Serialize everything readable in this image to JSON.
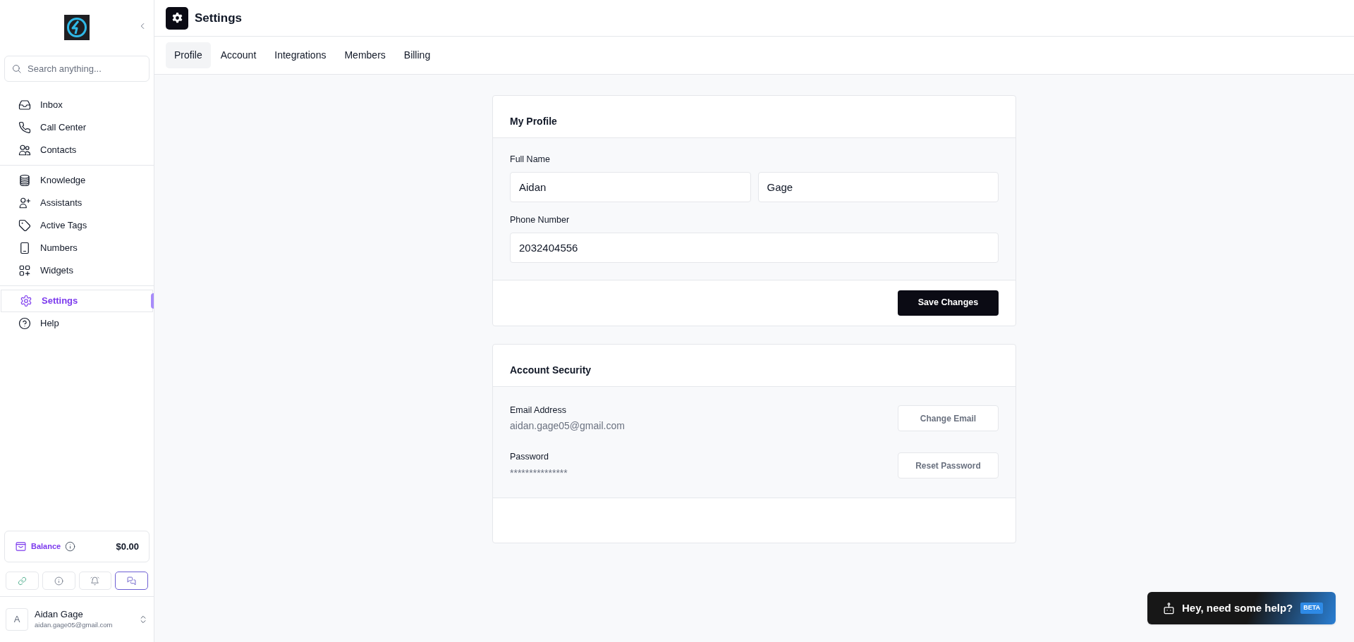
{
  "sidebar": {
    "search": {
      "placeholder": "Search anything..."
    },
    "nav_groups": [
      [
        {
          "kind": "inbox",
          "label": "Inbox",
          "selected": false
        },
        {
          "kind": "phone",
          "label": "Call Center",
          "selected": false
        },
        {
          "kind": "contacts",
          "label": "Contacts",
          "selected": false
        }
      ],
      [
        {
          "kind": "database",
          "label": "Knowledge",
          "selected": false
        },
        {
          "kind": "user-plus",
          "label": "Assistants",
          "selected": false
        },
        {
          "kind": "tag",
          "label": "Active Tags",
          "selected": false
        },
        {
          "kind": "mobile",
          "label": "Numbers",
          "selected": false
        },
        {
          "kind": "widgets",
          "label": "Widgets",
          "selected": false
        }
      ],
      [
        {
          "kind": "gear",
          "label": "Settings",
          "selected": true
        },
        {
          "kind": "help",
          "label": "Help",
          "selected": false
        }
      ]
    ],
    "balance": {
      "label": "Balance",
      "amount": "$0.00"
    },
    "quick_buttons": [
      {
        "kind": "link",
        "selected": false
      },
      {
        "kind": "info",
        "selected": false
      },
      {
        "kind": "bell",
        "selected": false
      },
      {
        "kind": "chat",
        "selected": true
      }
    ],
    "user": {
      "initial": "A",
      "name": "Aidan Gage",
      "email": "aidan.gage05@gmail.com"
    }
  },
  "header": {
    "title": "Settings"
  },
  "tabs": [
    {
      "label": "Profile",
      "selected": true
    },
    {
      "label": "Account",
      "selected": false
    },
    {
      "label": "Integrations",
      "selected": false
    },
    {
      "label": "Members",
      "selected": false
    },
    {
      "label": "Billing",
      "selected": false
    }
  ],
  "profile_card": {
    "title": "My Profile",
    "fields": [
      {
        "label": "Full Name",
        "values": [
          "Aidan",
          "Gage"
        ]
      },
      {
        "label": "Phone Number",
        "values": [
          "2032404556"
        ]
      }
    ],
    "save_button": "Save Changes"
  },
  "security_card": {
    "title": "Account Security",
    "rows": [
      {
        "label": "Email Address",
        "value": "aidan.gage05@gmail.com",
        "button": "Change Email"
      },
      {
        "label": "Password",
        "value": "***************",
        "button": "Reset Password"
      }
    ]
  },
  "help_widget": {
    "text": "Hey, need some help?",
    "badge": "BETA"
  }
}
